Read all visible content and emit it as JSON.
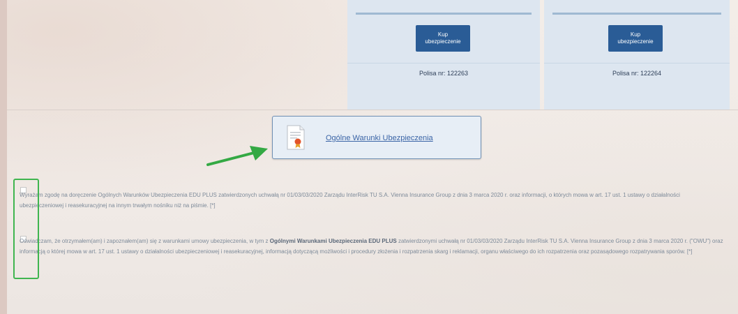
{
  "plans": [
    {
      "buy_label": "Kup ubezpieczenie",
      "policy_text": "Polisa nr: 122263"
    },
    {
      "buy_label": "Kup ubezpieczenie",
      "policy_text": "Polisa nr: 122264"
    }
  ],
  "owu": {
    "link_text": "Ogólne Warunki Ubezpieczenia",
    "icon": "document-certificate-icon"
  },
  "consents": [
    {
      "text": "Wyrażam zgodę na doręczenie Ogólnych Warunków Ubezpieczenia EDU PLUS zatwierdzonych uchwałą nr 01/03/03/2020 Zarządu InterRisk TU S.A. Vienna Insurance Group z dnia 3 marca 2020 r. oraz informacji, o których mowa w art. 17 ust. 1 ustawy o działalności ubezpieczeniowej i reasekuracyjnej na innym trwałym nośniku niż na piśmie. [*]"
    },
    {
      "text_before": "Oświadczam, że otrzymałem(am) i zapoznałem(am) się z warunkami umowy ubezpieczenia, w tym z ",
      "bold": "Ogólnymi Warunkami Ubezpieczenia EDU PLUS",
      "text_after": " zatwierdzonymi uchwałą nr 01/03/03/2020 Zarządu InterRisk TU S.A. Vienna Insurance Group z dnia 3 marca 2020 r. (\"OWU\") oraz informacją o której mowa w art. 17 ust. 1 ustawy o działalności ubezpieczeniowej i reasekuracyjnej, informacją dotyczącą możliwości i procedury złożenia i rozpatrzenia skarg i reklamacji, organu właściwego do ich rozpatrzenia oraz pozasądowego rozpatrywania sporów. [*]"
    }
  ],
  "colors": {
    "button": "#2a5c96",
    "highlight": "#3fb54f",
    "link": "#3a64a6"
  }
}
